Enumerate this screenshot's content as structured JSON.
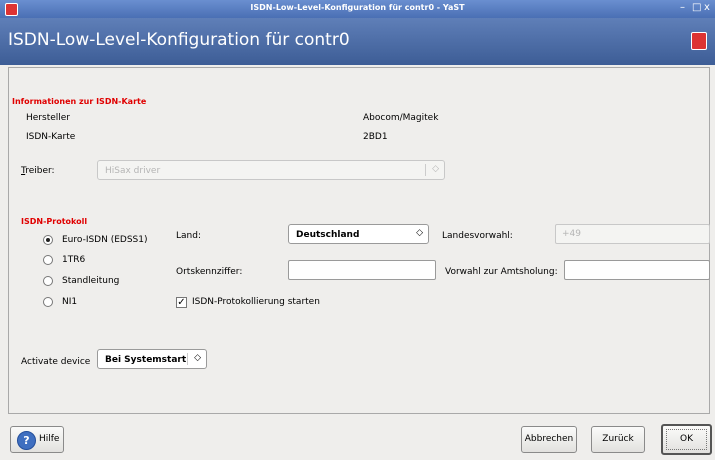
{
  "window": {
    "title": "ISDN-Low-Level-Konfiguration für contr0 - YaST",
    "controls": [
      "–",
      "□",
      "x"
    ]
  },
  "header": {
    "title": "ISDN-Low-Level-Konfiguration für contr0"
  },
  "card_info": {
    "heading": "Informationen zur ISDN-Karte",
    "manufacturer_label": "Hersteller",
    "manufacturer_value": "Abocom/Magitek",
    "card_label": "ISDN-Karte",
    "card_value": "2BD1"
  },
  "driver": {
    "label": "Treiber:",
    "value": "HiSax driver"
  },
  "protocol": {
    "heading": "ISDN-Protokoll",
    "options": [
      "Euro-ISDN (EDSS1)",
      "1TR6",
      "Standleitung",
      "NI1"
    ],
    "selected": "Euro-ISDN (EDSS1)"
  },
  "country": {
    "label": "Land:",
    "value": "Deutschland"
  },
  "area_code": {
    "label": "Landesvorwahl:",
    "value": "+49"
  },
  "local_code": {
    "label": "Ortskennziffer:",
    "value": ""
  },
  "outside_line": {
    "label": "Vorwahl zur Amtsholung:",
    "value": ""
  },
  "logging": {
    "label": "ISDN-Protokollierung starten",
    "checked": true
  },
  "activate": {
    "label": "Activate device",
    "value": "Bei Systemstart"
  },
  "buttons": {
    "help": "Hilfe",
    "cancel": "Abbrechen",
    "back": "Zurück",
    "ok": "OK"
  },
  "colors": {
    "heading_red": "#e00000",
    "header_blue": "#4a6fb4"
  }
}
